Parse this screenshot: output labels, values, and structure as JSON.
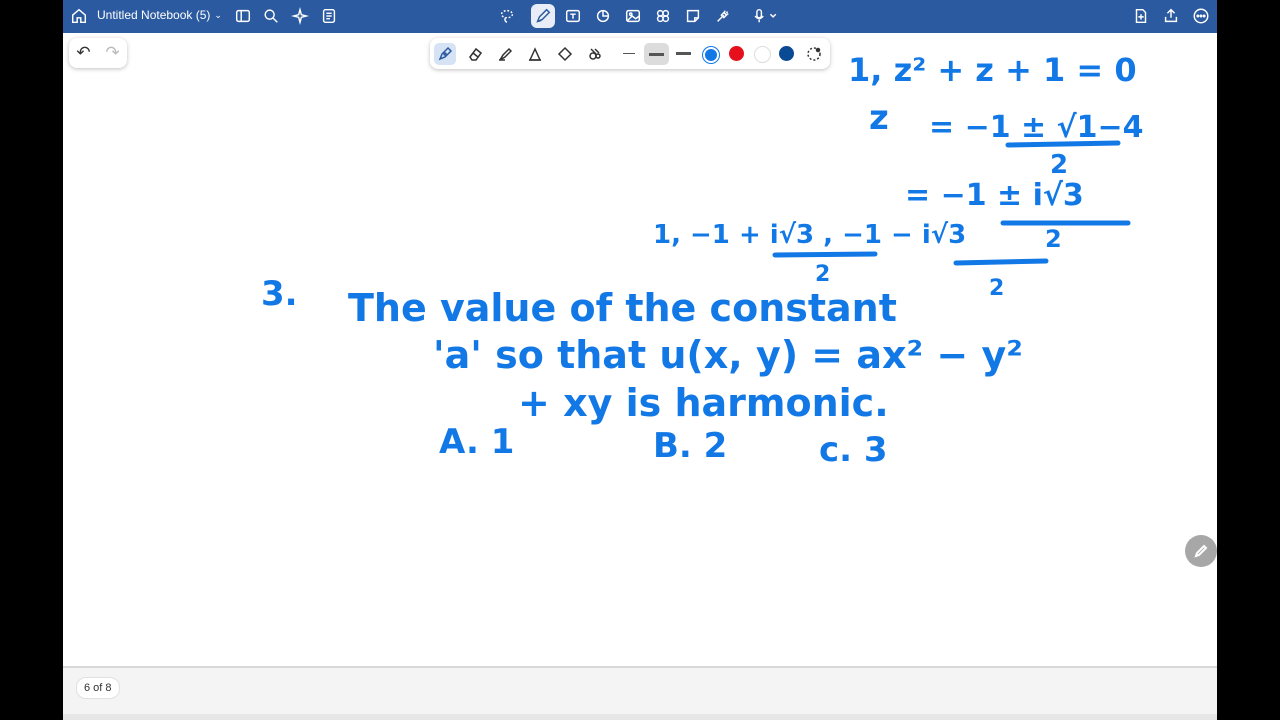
{
  "header": {
    "notebook_title": "Untitled Notebook (5)",
    "left_icons": [
      "home-icon",
      "sidebar-icon",
      "search-icon",
      "ai-sparkle-icon",
      "outline-icon"
    ],
    "center_tools": [
      "lasso-icon",
      "pen-icon",
      "text-box-icon",
      "shapes-icon",
      "image-icon",
      "sticker-icon",
      "sticky-note-icon",
      "laser-pointer-icon",
      "microphone-icon"
    ],
    "right_icons": [
      "add-page-icon",
      "share-icon",
      "more-icon"
    ],
    "accent": "#2c5aa0"
  },
  "undo_redo": {
    "undo": "↶",
    "redo": "↷"
  },
  "pen_toolbar": {
    "tools": [
      "fountain-pen-icon",
      "eraser-icon",
      "highlighter-icon",
      "shape-pen-icon",
      "lasso-select-icon",
      "tape-icon"
    ],
    "colors": [
      "#1278e6",
      "#e5101b",
      "#ffffff",
      "#0a4a94"
    ]
  },
  "ink": {
    "line1": "1,   z² + z + 1 = 0",
    "line2_lhs": "z",
    "line2_rhs": "= −1 ± √1−4",
    "line2_den": "2",
    "line3": "= −1 ± i√3",
    "line3_den": "2",
    "line4": "1,  −1 + i√3 ,  −1 − i√3",
    "line4_den": "2",
    "q_num": "3.",
    "q_line1": "The  value  of  the  constant",
    "q_line2": "'a'   so  that  u(x, y) = ax² − y²",
    "q_line3": "+ xy  is  harmonic.",
    "opt_a": "A.  1",
    "opt_b": "B. 2",
    "opt_c": "c. 3"
  },
  "footer": {
    "page_indicator": "6 of 8"
  }
}
